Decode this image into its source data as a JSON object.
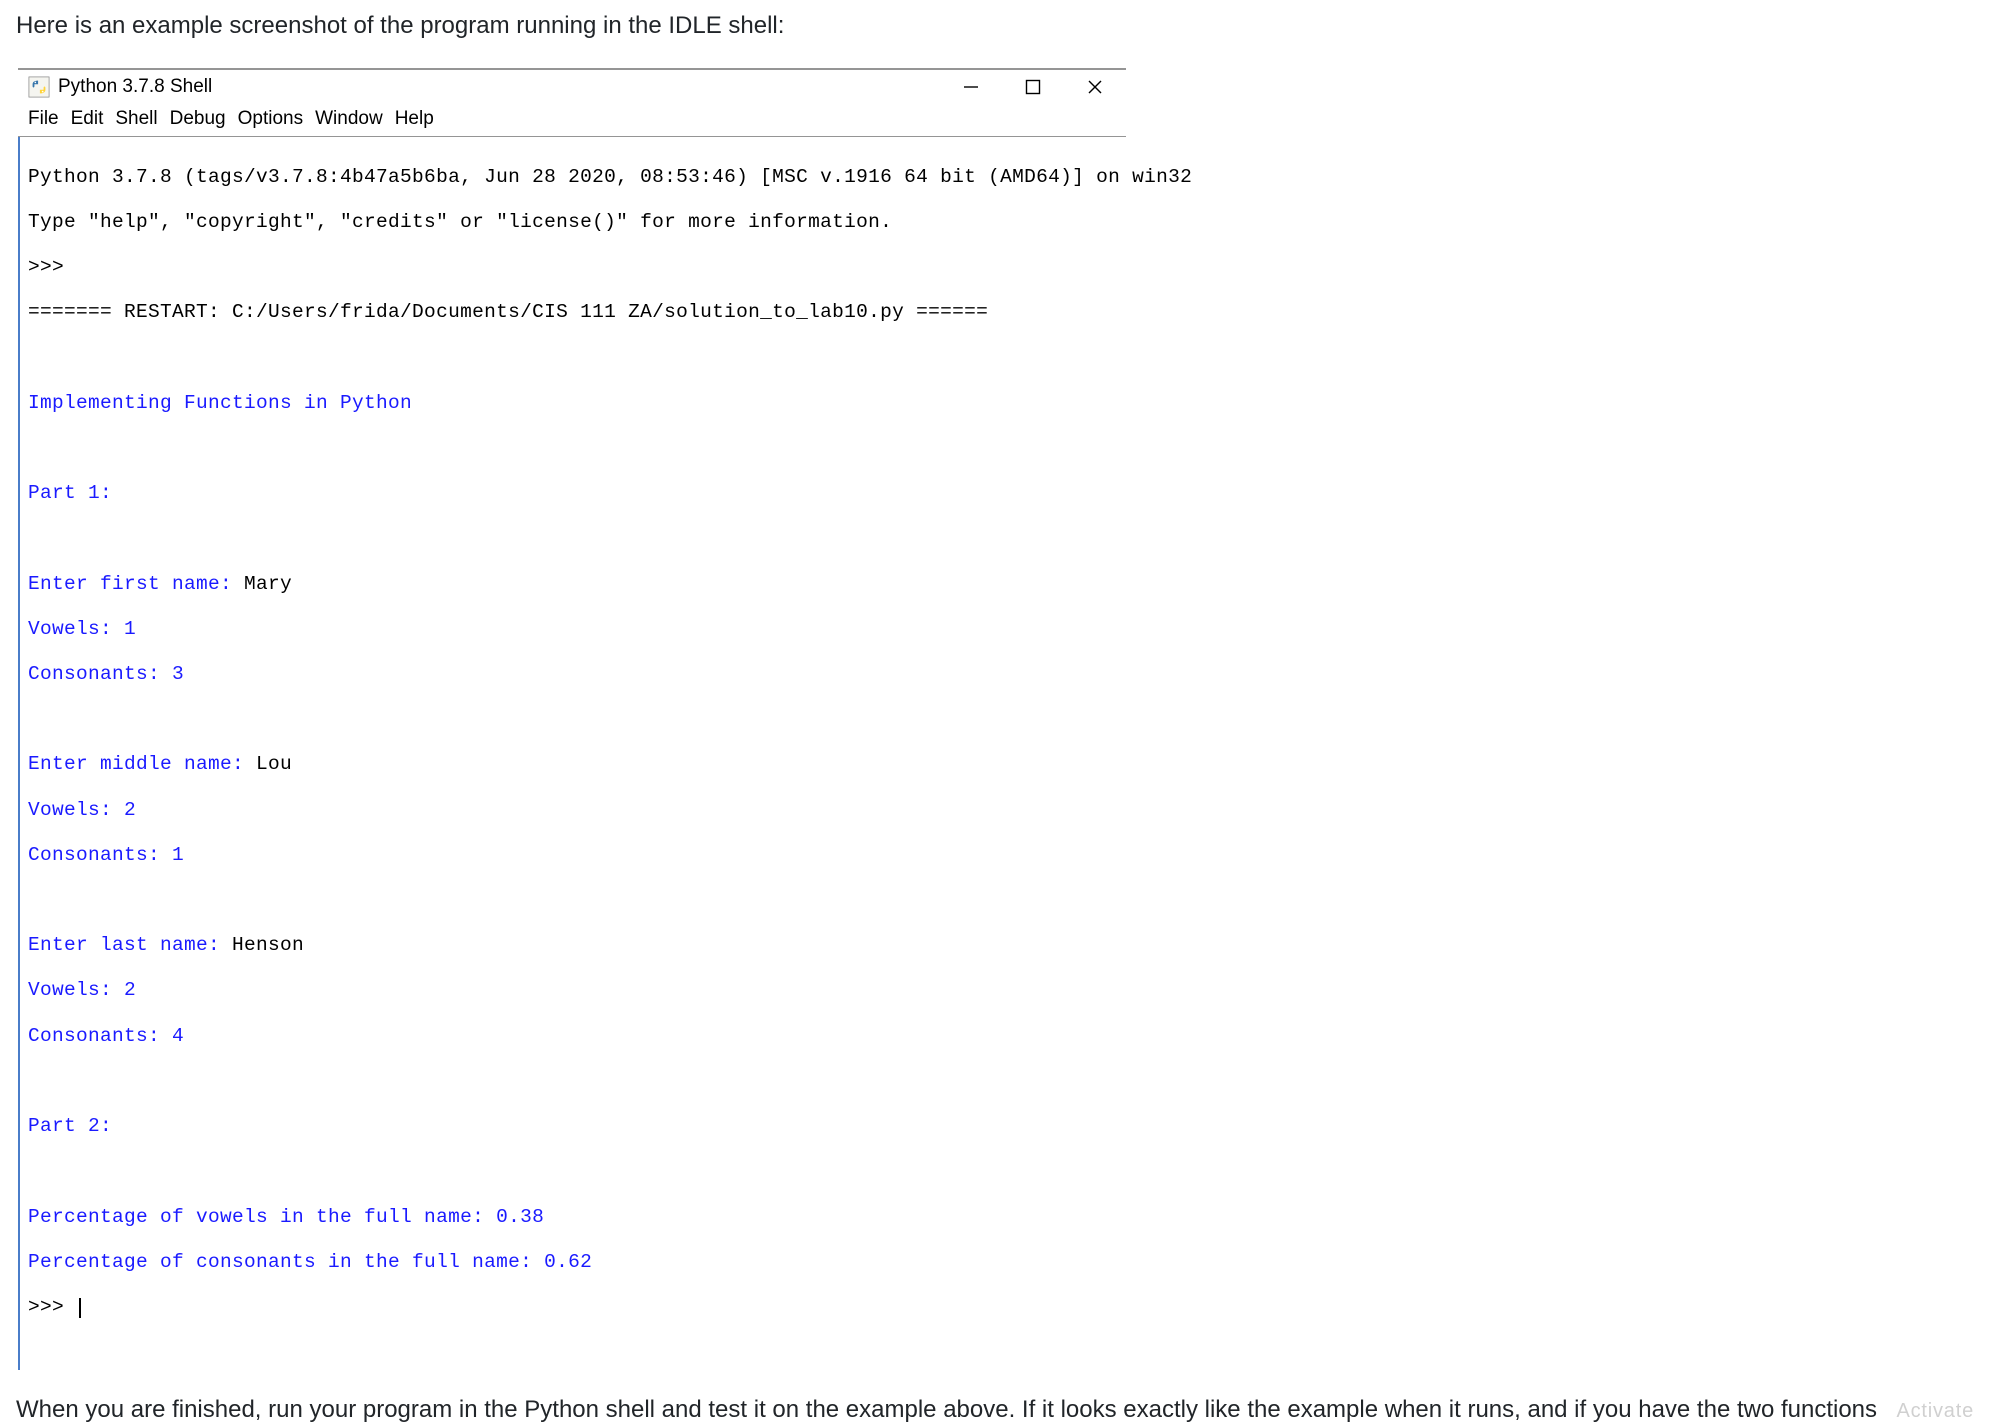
{
  "intro": "Here is an example screenshot of the program running in the IDLE shell:",
  "window": {
    "title": "Python 3.7.8 Shell",
    "menus": [
      "File",
      "Edit",
      "Shell",
      "Debug",
      "Options",
      "Window",
      "Help"
    ]
  },
  "shell": {
    "version_line": "Python 3.7.8 (tags/v3.7.8:4b47a5b6ba, Jun 28 2020, 08:53:46) [MSC v.1916 64 bit (AMD64)] on win32",
    "help_line": "Type \"help\", \"copyright\", \"credits\" or \"license()\" for more information.",
    "prompt1": ">>> ",
    "restart_line": "======= RESTART: C:/Users/frida/Documents/CIS 111 ZA/solution_to_lab10.py ======",
    "p_title": "Implementing Functions in Python",
    "part1": "Part 1:",
    "fn_prompt": "Enter first name: ",
    "fn_value": "Mary",
    "fn_vowels": "Vowels: 1",
    "fn_cons": "Consonants: 3",
    "mn_prompt": "Enter middle name: ",
    "mn_value": "Lou",
    "mn_vowels": "Vowels: 2",
    "mn_cons": "Consonants: 1",
    "ln_prompt": "Enter last name: ",
    "ln_value": "Henson",
    "ln_vowels": "Vowels: 2",
    "ln_cons": "Consonants: 4",
    "part2": "Part 2:",
    "pct_vowels": "Percentage of vowels in the full name: 0.38",
    "pct_cons": "Percentage of consonants in the full name: 0.62",
    "prompt2": ">>> "
  },
  "footer": "When you are finished, run your program in the Python shell and test it on the example above. If it looks exactly like the example when it runs, and if you have the two functions",
  "watermark": "Activate"
}
